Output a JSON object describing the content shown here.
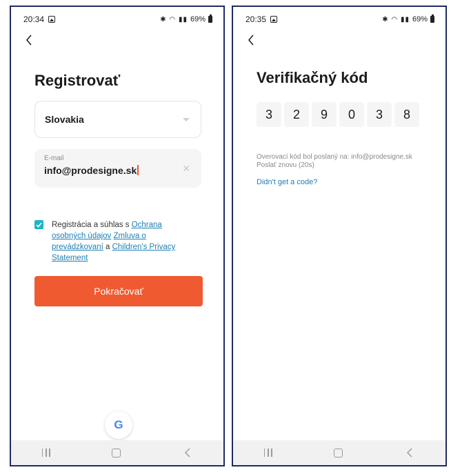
{
  "left_screen": {
    "status_bar": {
      "time": "20:34",
      "battery": "69%"
    },
    "title": "Registrovať",
    "country": {
      "value": "Slovakia"
    },
    "email": {
      "label": "E-mail",
      "value": "info@prodesigne.sk"
    },
    "consent": {
      "prefix": "Registrácia a súhlas s ",
      "link_privacy": "Ochrana osobných údajov",
      "link_terms": "Zmluva o prevádzkovaní",
      "connector": " a ",
      "link_children": "Children's Privacy Statement",
      "checked": true
    },
    "continue_label": "Pokračovať",
    "google_label": "G",
    "icons": [
      "gallery-icon",
      "chevron-left-icon",
      "close-icon",
      "check-icon",
      "google-icon",
      "recents-icon",
      "home-icon",
      "back-icon"
    ]
  },
  "right_screen": {
    "status_bar": {
      "time": "20:35",
      "battery": "69%"
    },
    "title": "Verifikačný kód",
    "code_digits": [
      "3",
      "2",
      "9",
      "0",
      "3",
      "8"
    ],
    "sent_info": "Overovací kód bol poslaný na: info@prodesigne.sk",
    "resend": "Poslať znovu (20s)",
    "no_code_link": "Didn't get a code?"
  },
  "colors": {
    "accent": "#f05a30",
    "link": "#1b7fb4",
    "checkbox": "#1cb5c4",
    "frame_border": "#1e2a63"
  }
}
